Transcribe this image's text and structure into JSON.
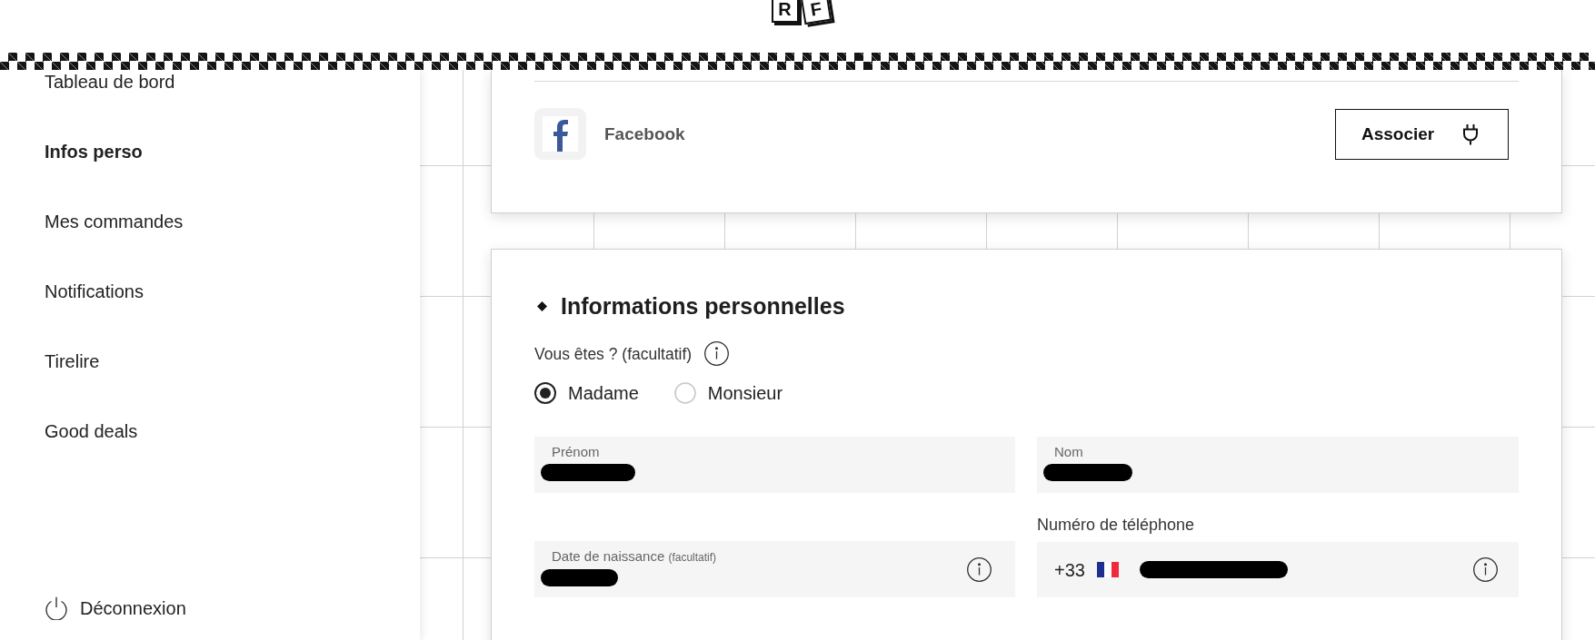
{
  "header": {
    "logo": {
      "letters": [
        "R",
        "F"
      ]
    }
  },
  "sidebar": {
    "items": [
      {
        "label": "Tableau de bord",
        "selected": false
      },
      {
        "label": "Infos perso",
        "selected": true
      },
      {
        "label": "Mes commandes",
        "selected": false
      },
      {
        "label": "Notifications",
        "selected": false
      },
      {
        "label": "Tirelire",
        "selected": false
      },
      {
        "label": "Good deals",
        "selected": false
      }
    ],
    "logout": "Déconnexion"
  },
  "linked_accounts": [
    {
      "name": "Facebook",
      "button": "Associer"
    }
  ],
  "personal_info": {
    "title": "Informations personnelles",
    "civility": {
      "label": "Vous êtes ? (facultatif)",
      "info": true,
      "options": [
        {
          "label": "Madame",
          "selected": true
        },
        {
          "label": "Monsieur",
          "selected": false
        }
      ]
    },
    "fields": [
      {
        "kind": "floating",
        "label": "Prénom",
        "redacted": true,
        "info": false
      },
      {
        "kind": "floating",
        "label": "Nom",
        "redacted": true,
        "info": false
      },
      {
        "kind": "floating",
        "label": "Date de naissance",
        "label_note": "(facultatif)",
        "redacted": true,
        "info": true
      },
      {
        "kind": "phone",
        "label": "Numéro de téléphone",
        "prefix": "+33",
        "redacted": true,
        "info": true
      }
    ]
  }
}
